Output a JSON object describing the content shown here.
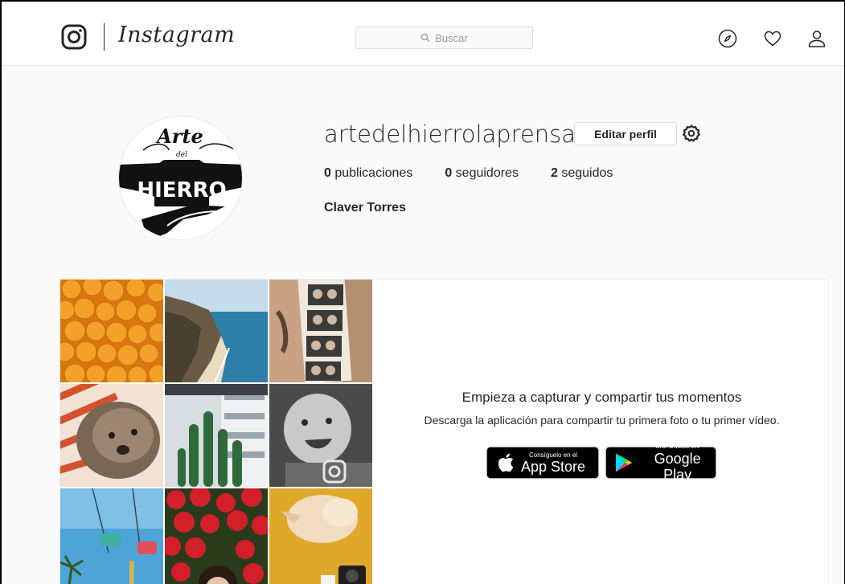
{
  "header": {
    "wordmark": "Instagram",
    "search_placeholder": "Buscar",
    "icons": [
      "instagram-camera-icon",
      "search-icon",
      "explore-compass-icon",
      "activity-heart-icon",
      "profile-person-icon"
    ]
  },
  "profile": {
    "username": "artedelhierrolaprensa",
    "edit_label": "Editar perfil",
    "full_name": "Claver Torres",
    "avatar_logo_text": [
      "Arte",
      "del",
      "HIERRO"
    ],
    "stats": [
      {
        "count": "0",
        "label": "publicaciones"
      },
      {
        "count": "0",
        "label": "seguidores"
      },
      {
        "count": "2",
        "label": "seguidos"
      }
    ]
  },
  "promo": {
    "title": "Empieza a capturar y compartir tus momentos",
    "subtitle": "Descarga la aplicación para compartir tu primera foto o tu primer vídeo.",
    "app_store": {
      "small": "Consíguelo en el",
      "big": "App Store"
    },
    "google_play": {
      "small": "DISPONIBLE EN",
      "big": "Google Play"
    }
  },
  "colors": {
    "text": "#262626",
    "border": "#dbdbdb",
    "background": "#fafafa",
    "secondary_text": "#999999"
  }
}
